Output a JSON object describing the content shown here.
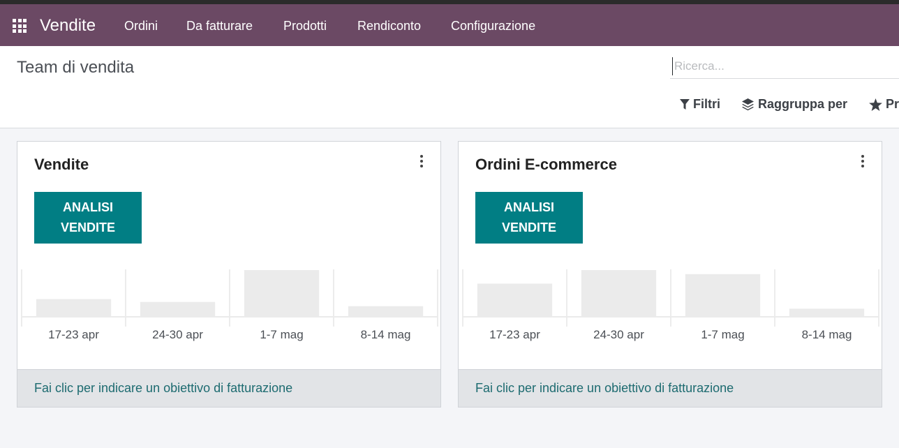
{
  "navbar": {
    "brand": "Vendite",
    "menu": [
      "Ordini",
      "Da fatturare",
      "Prodotti",
      "Rendiconto",
      "Configurazione"
    ]
  },
  "control_panel": {
    "title": "Team di vendita",
    "search_placeholder": "Ricerca...",
    "filters_label": "Filtri",
    "group_by_label": "Raggruppa per",
    "favorites_label": "Pr"
  },
  "cards": [
    {
      "title": "Vendite",
      "button_label": "ANALISI VENDITE",
      "footer_link": "Fai clic per indicare un obiettivo di fatturazione",
      "chart_data": {
        "type": "bar",
        "categories": [
          "17-23 apr",
          "24-30 apr",
          "1-7 mag",
          "8-14 mag"
        ],
        "values": [
          24,
          20,
          65,
          14
        ]
      }
    },
    {
      "title": "Ordini E-commerce",
      "button_label": "ANALISI VENDITE",
      "footer_link": "Fai clic per indicare un obiettivo di fatturazione",
      "chart_data": {
        "type": "bar",
        "categories": [
          "17-23 apr",
          "24-30 apr",
          "1-7 mag",
          "8-14 mag"
        ],
        "values": [
          48,
          68,
          62,
          11
        ]
      }
    }
  ],
  "colors": {
    "navbar": "#6b4964",
    "primary_button": "#017e84",
    "bar_fill": "#ebebeb",
    "link": "#1d6b70"
  }
}
